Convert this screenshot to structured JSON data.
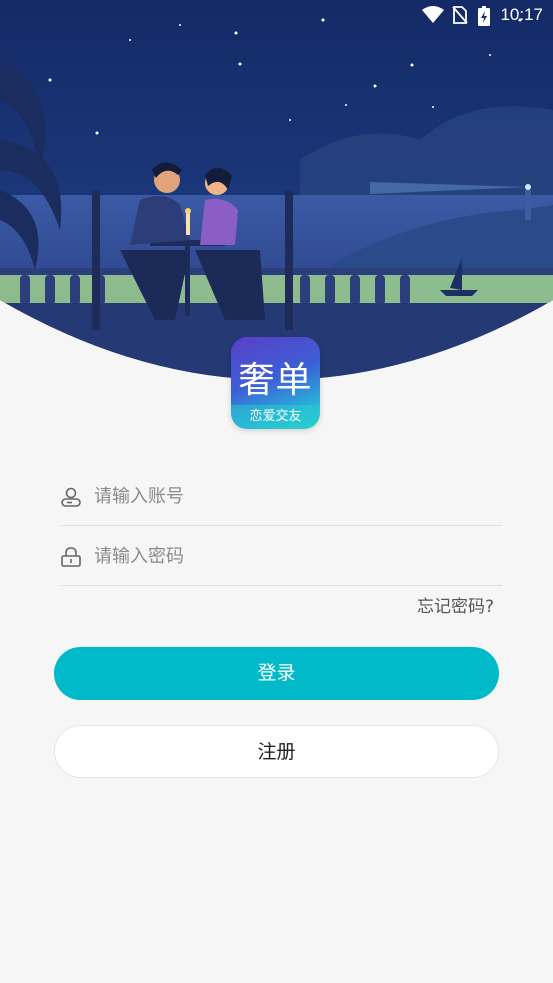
{
  "status_bar": {
    "time": "10:17",
    "icons": [
      "wifi-icon",
      "no-sim-icon",
      "battery-charging-icon"
    ]
  },
  "logo": {
    "title": "奢单",
    "subtitle": "恋爱交友"
  },
  "form": {
    "account_placeholder": "请输入账号",
    "password_placeholder": "请输入密码",
    "account_icon": "user-icon",
    "password_icon": "lock-icon",
    "forgot_label": "忘记密码?"
  },
  "buttons": {
    "login_label": "登录",
    "register_label": "注册"
  },
  "colors": {
    "primary": "#00b9c9",
    "background": "#f6f6f6",
    "hero_sky": "#1a2f6e"
  }
}
